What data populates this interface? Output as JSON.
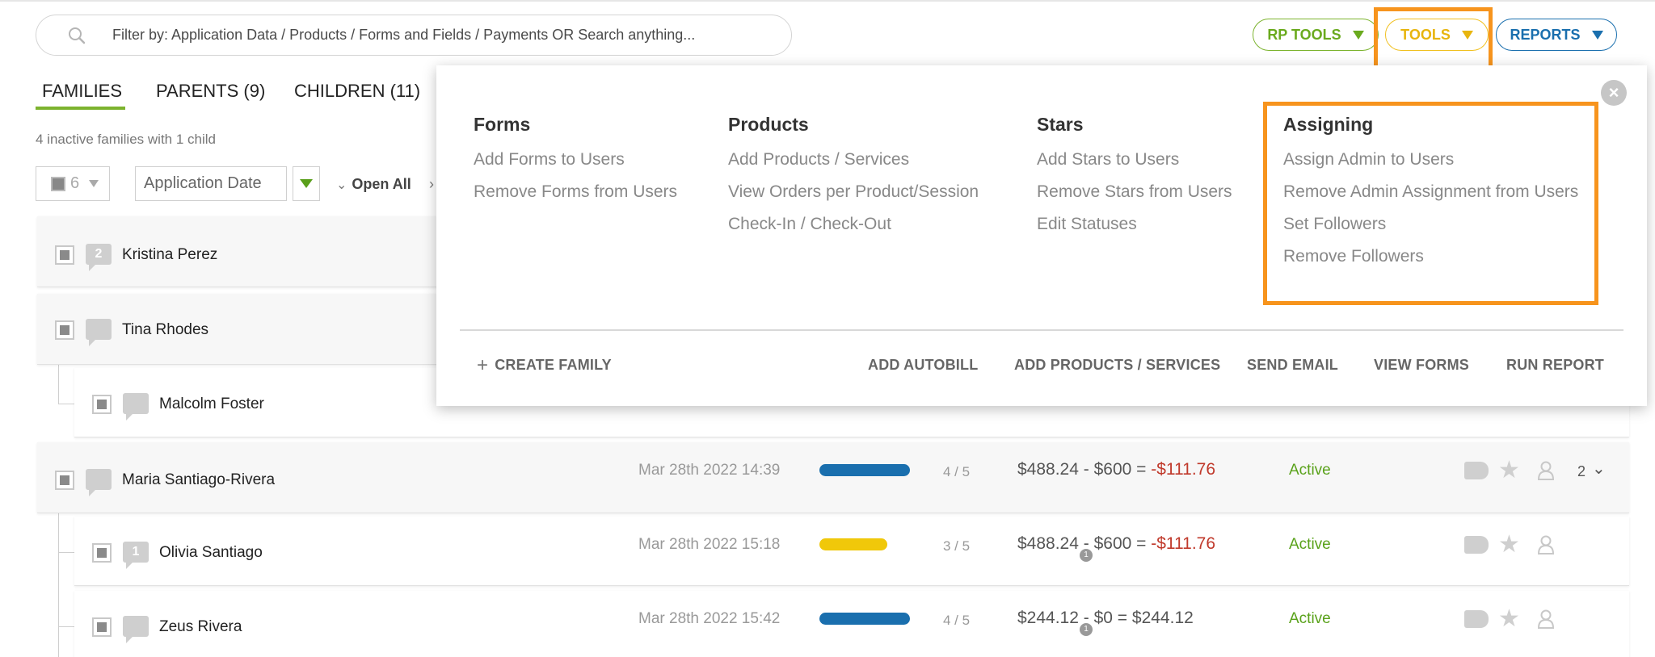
{
  "search": {
    "placeholder": "Filter by: Application Data / Products / Forms and Fields / Payments OR Search anything..."
  },
  "top_buttons": {
    "rp_tools": "RP TOOLS",
    "tools": "TOOLS",
    "reports": "REPORTS"
  },
  "tabs": [
    {
      "label": "FAMILIES",
      "active": true
    },
    {
      "label": "PARENTS (9)"
    },
    {
      "label": "CHILDREN (11)"
    }
  ],
  "inactive_note": "4 inactive families with 1 child",
  "filter": {
    "selected_count": "6",
    "sort_field": "Application Date",
    "open_all": "Open All"
  },
  "rows": [
    {
      "name": "Kristina Perez",
      "badge": "2"
    },
    {
      "name": "Tina Rhodes",
      "badge": ""
    },
    {
      "name": "Malcolm Foster",
      "badge": ""
    },
    {
      "name": "Maria Santiago-Rivera",
      "badge": "",
      "date": "Mar 28th 2022 14:39",
      "progress": 0.8,
      "progress_color": "#1a6fae",
      "fraction": "4 / 5",
      "paid": "$488.24",
      "owed": "$600",
      "balance": "-$111.76",
      "status": "Active",
      "count": "2"
    },
    {
      "name": "Olivia Santiago",
      "badge": "1",
      "date": "Mar 28th 2022 15:18",
      "progress": 0.6,
      "progress_color": "#f0c80a",
      "fraction": "3 / 5",
      "paid": "$488.24",
      "owed": "$600",
      "balance": "-$111.76",
      "status": "Active",
      "mini": "1"
    },
    {
      "name": "Zeus Rivera",
      "badge": "",
      "date": "Mar 28th 2022 15:42",
      "progress": 0.8,
      "progress_color": "#1a6fae",
      "fraction": "4 / 5",
      "paid": "$244.12",
      "owed": "$0",
      "balance": "$244.12",
      "status": "Active",
      "mini": "1"
    }
  ],
  "tools_menu": {
    "forms": {
      "title": "Forms",
      "items": [
        "Add Forms to Users",
        "Remove Forms from Users"
      ]
    },
    "products": {
      "title": "Products",
      "items": [
        "Add Products / Services",
        "View Orders per Product/Session",
        "Check-In / Check-Out"
      ]
    },
    "stars": {
      "title": "Stars",
      "items": [
        "Add Stars to Users",
        "Remove Stars from Users",
        "Edit Statuses"
      ]
    },
    "assigning": {
      "title": "Assigning",
      "items": [
        "Assign Admin to Users",
        "Remove Admin Assignment from Users",
        "Set Followers",
        "Remove Followers"
      ]
    },
    "footer": {
      "create_family": "CREATE FAMILY",
      "add_autobill": "ADD AUTOBILL",
      "add_products": "ADD PRODUCTS / SERVICES",
      "send_email": "SEND EMAIL",
      "view_forms": "VIEW FORMS",
      "run_report": "RUN REPORT"
    }
  },
  "colors": {
    "accent_green": "#7cb32e",
    "tools_yellow": "#f0c020",
    "reports_blue": "#1a6fae",
    "highlight_orange": "#f7941d",
    "negative_red": "#c0392b"
  }
}
